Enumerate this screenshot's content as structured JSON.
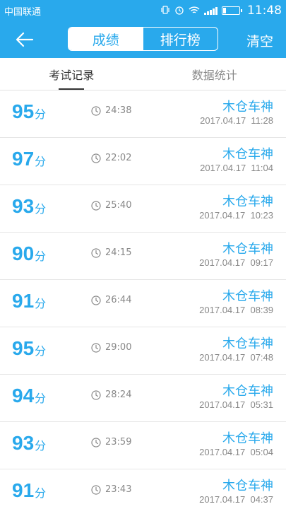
{
  "status_bar": {
    "carrier": "中国联通",
    "time": "11:48"
  },
  "header": {
    "tabs": [
      "成绩",
      "排行榜"
    ],
    "active_tab": "成绩",
    "clear_label": "清空"
  },
  "sub_tabs": [
    "考试记录",
    "数据统计"
  ],
  "score_unit": "分",
  "records": [
    {
      "score": "95",
      "duration": "24:38",
      "user": "木仓车神",
      "datetime": "2017.04.17  11:28"
    },
    {
      "score": "97",
      "duration": "22:02",
      "user": "木仓车神",
      "datetime": "2017.04.17  11:04"
    },
    {
      "score": "93",
      "duration": "25:40",
      "user": "木仓车神",
      "datetime": "2017.04.17  10:23"
    },
    {
      "score": "90",
      "duration": "24:15",
      "user": "木仓车神",
      "datetime": "2017.04.17  09:17"
    },
    {
      "score": "91",
      "duration": "26:44",
      "user": "木仓车神",
      "datetime": "2017.04.17  08:39"
    },
    {
      "score": "95",
      "duration": "29:00",
      "user": "木仓车神",
      "datetime": "2017.04.17  07:48"
    },
    {
      "score": "94",
      "duration": "28:24",
      "user": "木仓车神",
      "datetime": "2017.04.17  05:31"
    },
    {
      "score": "93",
      "duration": "23:59",
      "user": "木仓车神",
      "datetime": "2017.04.17  05:04"
    },
    {
      "score": "91",
      "duration": "23:43",
      "user": "木仓车神",
      "datetime": "2017.04.17  04:37"
    }
  ],
  "colors": {
    "accent": "#29a9ec",
    "secondary_text": "#888888"
  }
}
